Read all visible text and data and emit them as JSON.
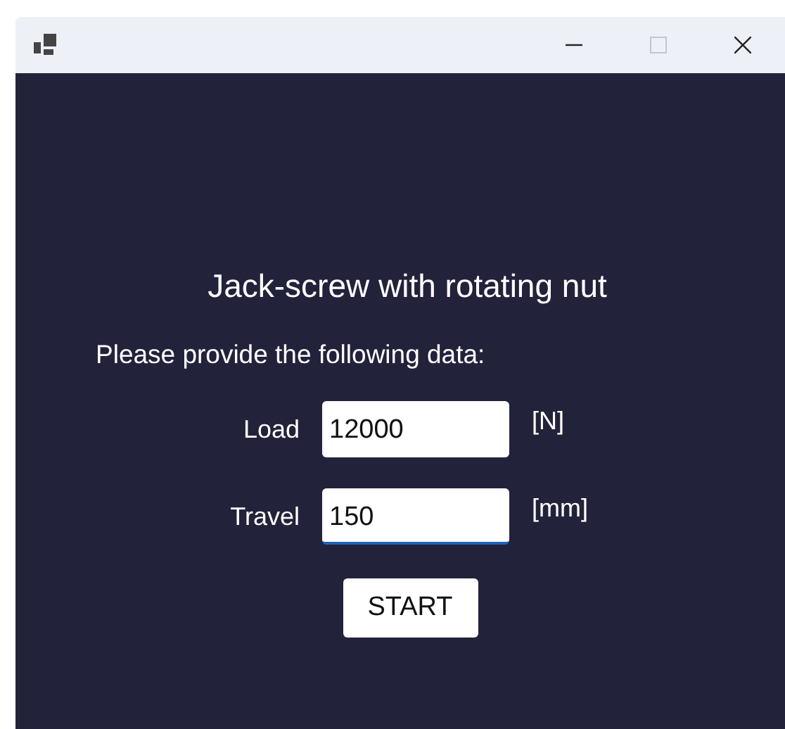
{
  "window": {
    "maximize_disabled": true
  },
  "heading": "Jack-screw with rotating nut",
  "prompt": "Please provide the following data:",
  "fields": [
    {
      "label": "Load",
      "value": "12000",
      "unit": "[N]",
      "focused": false
    },
    {
      "label": "Travel",
      "value": "150",
      "unit": "[mm]",
      "focused": true
    }
  ],
  "button": "START"
}
